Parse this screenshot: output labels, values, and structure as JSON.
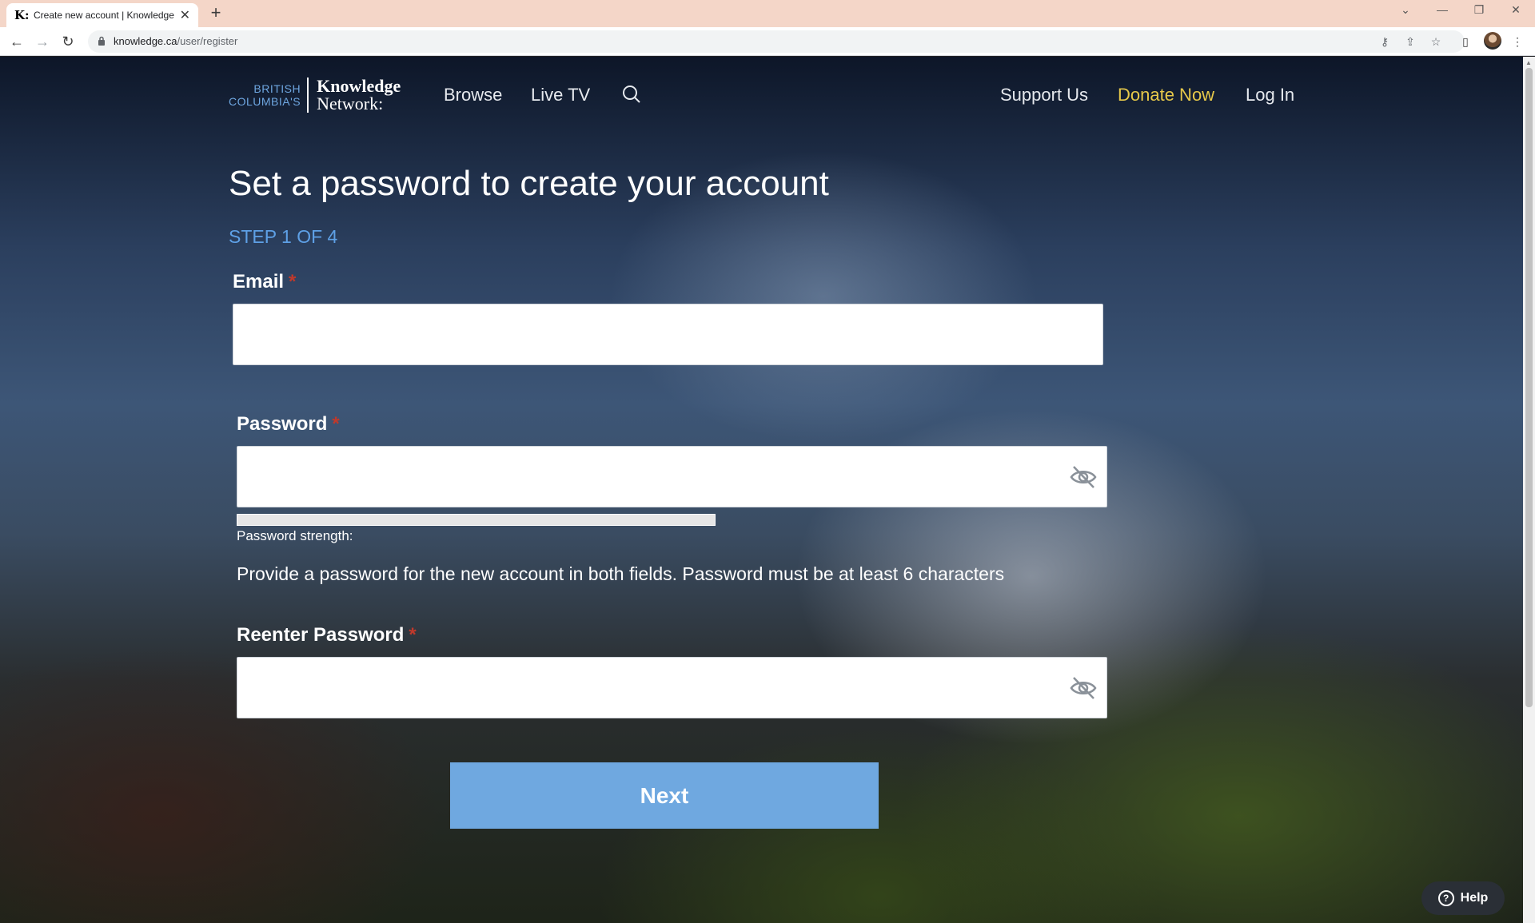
{
  "browser": {
    "tab": {
      "favicon": "K:",
      "title": "Create new account | Knowledge",
      "close": "✕"
    },
    "new_tab": "+",
    "window_controls": {
      "tabs_dropdown": "⌄",
      "minimize": "—",
      "restore": "❐",
      "close": "✕"
    },
    "nav": {
      "back": "←",
      "forward": "→",
      "reload": "↻"
    },
    "url": {
      "host": "knowledge.ca",
      "path": "/user/register"
    }
  },
  "site": {
    "logo": {
      "small_line1": "BRITISH",
      "small_line2": "COLUMBIA'S",
      "big_line1": "Knowledge",
      "big_line2": "Network:"
    },
    "nav": {
      "browse": "Browse",
      "live_tv": "Live TV",
      "support_us": "Support Us",
      "donate_now": "Donate Now",
      "log_in": "Log In"
    },
    "colors": {
      "accent": "#6fa8e0",
      "donate": "#e6c84a",
      "step": "#5ea0e6"
    }
  },
  "form": {
    "heading": "Set a password to create your account",
    "step": "STEP 1 OF 4",
    "email_label": "Email",
    "email_value": "",
    "password_label": "Password",
    "password_value": "",
    "password_strength_label": "Password strength:",
    "password_strength": 0,
    "help_text": "Provide a password for the new account in both fields. Password must be at least 6 characters",
    "reenter_label": "Reenter Password",
    "reenter_value": "",
    "required_mark": "*",
    "next_button": "Next"
  },
  "help_widget": {
    "icon": "?",
    "label": "Help"
  }
}
